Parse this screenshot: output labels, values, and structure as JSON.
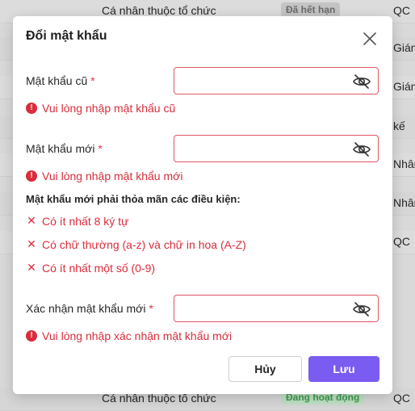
{
  "background": {
    "rows": [
      {
        "col2": "Cá nhân thuộc tổ chức",
        "badge": "Đã hết hạn",
        "col4": "QC"
      },
      {
        "col4": "Giáng"
      },
      {
        "col4": "Giáng"
      },
      {
        "col4": "kế"
      },
      {
        "col4": "Nhân"
      },
      {
        "col4": "Nhân"
      },
      {
        "col4": "QC"
      },
      {
        "col2": "Cá nhân thuộc tổ chức",
        "badge": "Đang hoạt động",
        "col4": "QC"
      }
    ]
  },
  "dialog": {
    "title": "Đổi mật khẩu",
    "close_icon": "close-icon",
    "fields": [
      {
        "label": "Mật khẩu cũ",
        "required": "*",
        "value": "",
        "error": "Vui lòng nhập mật khẩu cũ"
      },
      {
        "label": "Mật khẩu mới",
        "required": "*",
        "value": "",
        "error": "Vui lòng nhập mật khẩu mới"
      },
      {
        "label": "Xác nhận mật khẩu mới",
        "required": "*",
        "value": "",
        "error": "Vui lòng nhập xác nhận mật khẩu mới"
      }
    ],
    "conditions_title": "Mật khẩu mới phải thỏa mãn các điều kiện:",
    "conditions": [
      {
        "mark": "✕",
        "text": "Có ít nhất 8 ký tự"
      },
      {
        "mark": "✕",
        "text": "Có chữ thường (a-z) và chữ in hoa (A-Z)"
      },
      {
        "mark": "✕",
        "text": "Có ít nhất một số (0-9)"
      }
    ],
    "cancel_label": "Hủy",
    "save_label": "Lưu"
  },
  "colors": {
    "error": "#d92d3c",
    "primary": "#7a5cf0",
    "input_error_border": "#e05563"
  }
}
